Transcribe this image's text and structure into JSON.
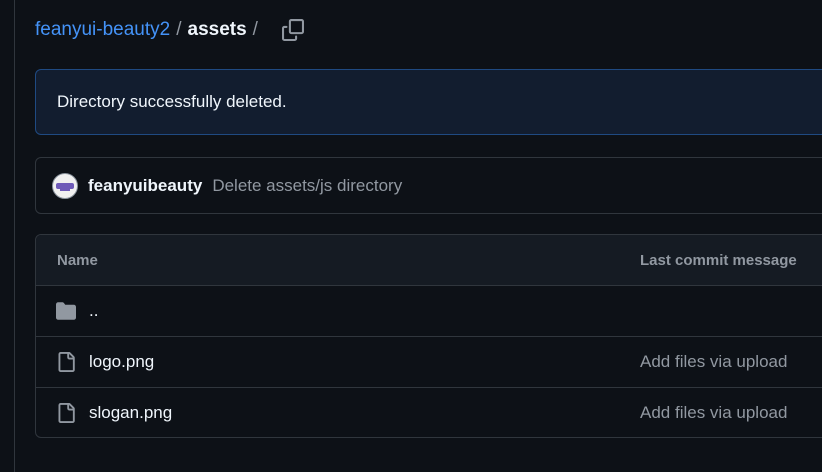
{
  "breadcrumb": {
    "repo": "feanyui-beauty2",
    "separator": "/",
    "current": "assets",
    "trailing_separator": "/",
    "copy_icon": "copy-icon"
  },
  "flash": {
    "message": "Directory successfully deleted."
  },
  "latest_commit": {
    "avatar": "avatar",
    "author": "feanyuibeauty",
    "message": "Delete assets/js directory"
  },
  "file_table": {
    "columns": {
      "name": "Name",
      "last_commit": "Last commit message"
    },
    "rows": [
      {
        "icon": "folder-icon",
        "name": "..",
        "message": ""
      },
      {
        "icon": "file-icon",
        "name": "logo.png",
        "message": "Add files via upload"
      },
      {
        "icon": "file-icon",
        "name": "slogan.png",
        "message": "Add files via upload"
      }
    ]
  },
  "colors": {
    "background": "#0d1117",
    "link": "#4493f8",
    "muted": "#9198a1",
    "border": "#30363d",
    "flash_bg": "#121d2f",
    "flash_border": "#1f4a82"
  }
}
